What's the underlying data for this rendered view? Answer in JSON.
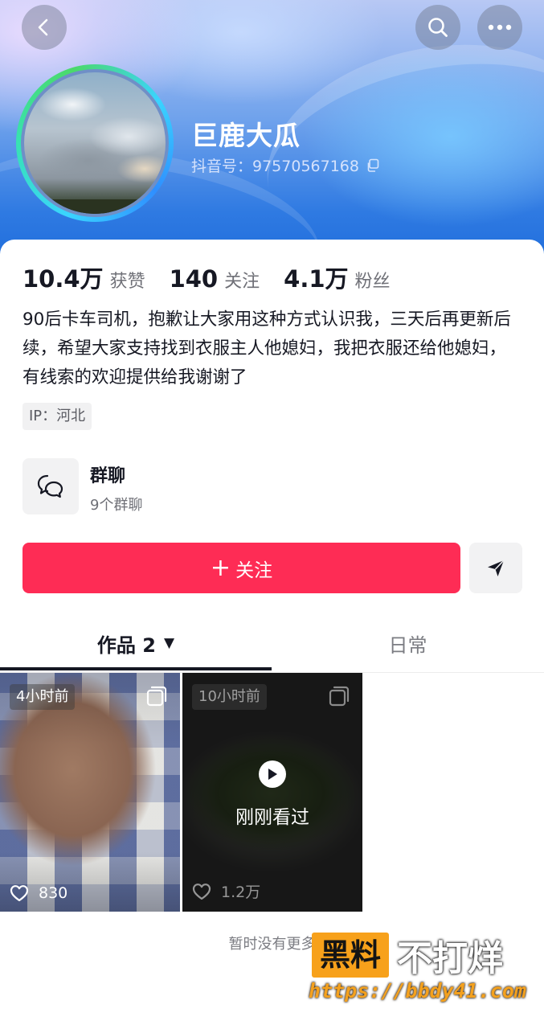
{
  "header": {
    "back_icon": "chevron-left-icon",
    "search_icon": "search-icon",
    "more_icon": "more-dots-icon"
  },
  "profile": {
    "username": "巨鹿大瓜",
    "douyin_id": "抖音号：97570567168"
  },
  "stats": [
    {
      "value": "10.4万",
      "label": "获赞"
    },
    {
      "value": "140",
      "label": "关注"
    },
    {
      "value": "4.1万",
      "label": "粉丝"
    }
  ],
  "bio": "90后卡车司机，抱歉让大家用这种方式认识我，三天后再更新后续，希望大家支持找到衣服主人他媳妇，我把衣服还给他媳妇，有线索的欢迎提供给我谢谢了",
  "ip": "IP：河北",
  "group": {
    "title": "群聊",
    "subtitle": "9个群聊"
  },
  "actions": {
    "follow_plus": "+",
    "follow_label": "关注"
  },
  "tabs": {
    "works_label": "作品 2",
    "works_caret": "▼",
    "daily_label": "日常"
  },
  "videos": [
    {
      "time": "4小时前",
      "likes": "830"
    },
    {
      "time": "10小时前",
      "likes": "1.2万",
      "overlay": "刚刚看过"
    }
  ],
  "footer": {
    "no_more": "暂时没有更多"
  },
  "watermark": {
    "brand_box": "黑料",
    "brand_rest": "不打烊",
    "url": "https://bbdy41.com"
  },
  "colors": {
    "accent": "#fe2c55",
    "watermark_orange": "#f7a11b"
  }
}
